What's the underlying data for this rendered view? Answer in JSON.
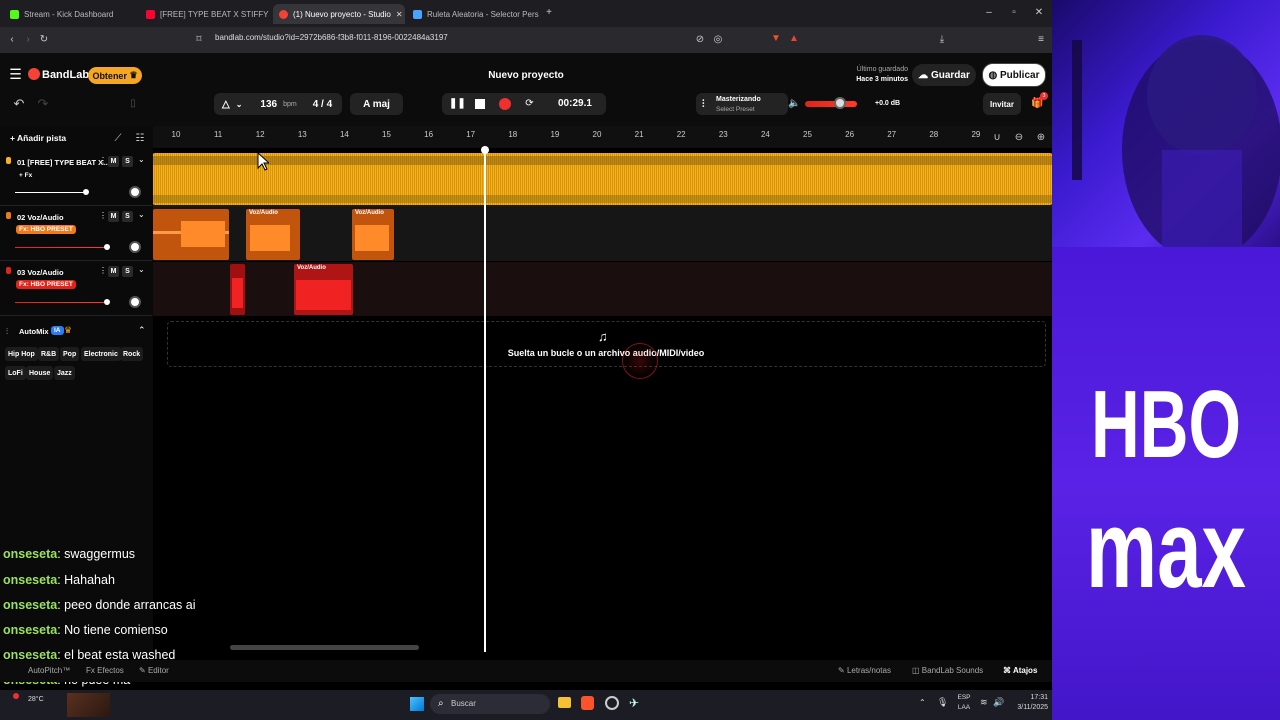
{
  "browser": {
    "tabs": [
      {
        "label": "Stream - Kick Dashboard",
        "color": "#53fc18"
      },
      {
        "label": "[FREE] TYPE BEAT X STIFFY X AGUSF",
        "color": "#ff0033"
      },
      {
        "label": "(1) Nuevo proyecto - Studio",
        "color": "#f44336",
        "active": true
      },
      {
        "label": "Ruleta Aleatoria - Selector Personaliz",
        "color": "#4aa3ff"
      }
    ],
    "url": "bandlab.com/studio?id=2972b686-f3b8-f011-8196-0022484a3197"
  },
  "header": {
    "brand": "BandLab",
    "obtener": "Obtener",
    "project_title": "Nuevo proyecto",
    "last_saved_label": "Último guardado",
    "last_saved_time": "Hace 3 minutos",
    "save": "Guardar",
    "publish": "Publicar"
  },
  "transport": {
    "bpm_value": "136",
    "bpm_unit": "bpm",
    "time_sig": "4 / 4",
    "key": "A maj",
    "time": "00:29.1",
    "mastering_label": "Masterizando",
    "mastering_preset": "Select Preset",
    "volume_db": "+0.0 dB",
    "invite": "Invitar",
    "notif_count": "3"
  },
  "ruler": {
    "ticks": [
      "10",
      "11",
      "12",
      "13",
      "14",
      "15",
      "16",
      "17",
      "18",
      "19",
      "20",
      "21",
      "22",
      "23",
      "24",
      "25",
      "26",
      "27",
      "28",
      "29"
    ]
  },
  "add_track": "Añadir pista",
  "tracks": [
    {
      "name": "01  [FREE] TYPE BEAT X...",
      "fx": "+ Fx",
      "m": "M",
      "s": "S"
    },
    {
      "name": "02  Voz/Audio",
      "fx": "Fx: HBO PRESET",
      "m": "M",
      "s": "S"
    },
    {
      "name": "03  Voz/Audio",
      "fx": "Fx: HBO PRESET",
      "m": "M",
      "s": "S"
    }
  ],
  "clips": {
    "voz": "Voz/Audio"
  },
  "automix": {
    "label": "AutoMix",
    "badge": "IA",
    "genres": [
      "Hip Hop",
      "R&B",
      "Pop",
      "Electronic",
      "Rock",
      "LoFi",
      "House",
      "Jazz"
    ]
  },
  "dropzone": "Suelta un bucle o un archivo audio/MIDI/video",
  "chat": [
    {
      "user": "onseseta",
      "msg": "swaggermus"
    },
    {
      "user": "onseseta",
      "msg": "Hahahah"
    },
    {
      "user": "onseseta",
      "msg": "peeo donde arrancas ai"
    },
    {
      "user": "onseseta",
      "msg": "No tiene comienso"
    },
    {
      "user": "onseseta",
      "msg": "el beat esta washed"
    },
    {
      "user": "onseseta",
      "msg": "no puee ma"
    }
  ],
  "footer": {
    "autopitch": "AutoPitch™",
    "efectos": "Efectos",
    "editor": "Editor",
    "letras": "Letras/notas",
    "sounds": "BandLab Sounds",
    "atajos": "Atajos"
  },
  "taskbar": {
    "weather": "28°C",
    "search": "Buscar",
    "lang1": "ESP",
    "lang2": "LAA",
    "clock_time": "17:31",
    "clock_date": "3/11/2025"
  },
  "overlay": {
    "hbo": "HBO",
    "max": "max"
  }
}
